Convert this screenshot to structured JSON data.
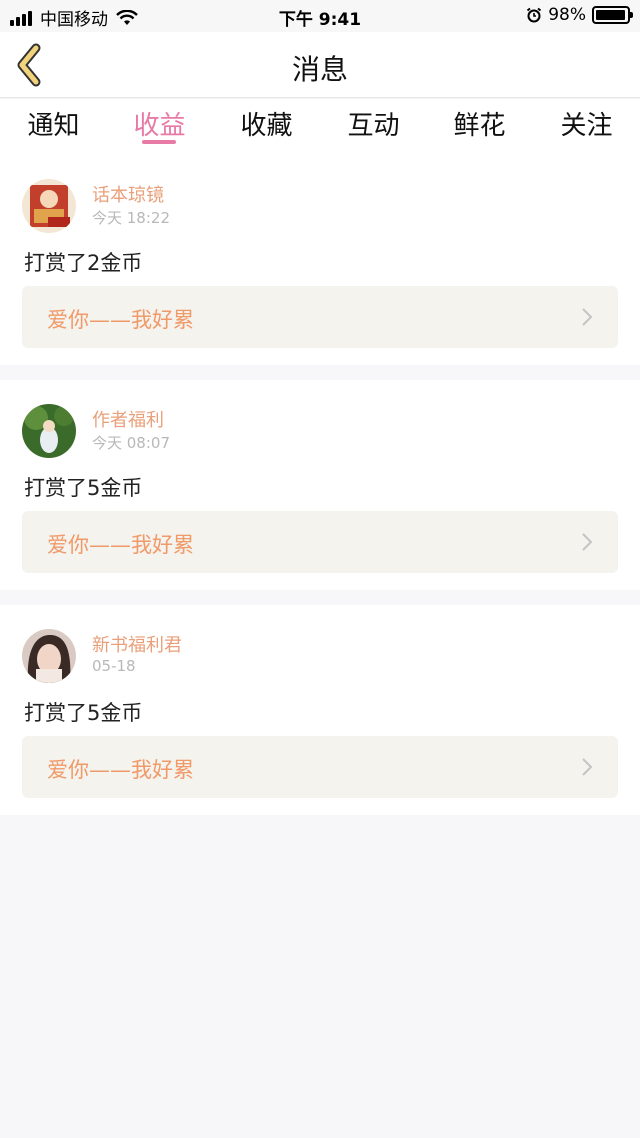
{
  "status": {
    "carrier": "中国移动",
    "time": "下午 9:41",
    "battery": "98%",
    "battery_level": 0.98
  },
  "nav": {
    "title": "消息"
  },
  "tabs": [
    {
      "label": "通知"
    },
    {
      "label": "收益"
    },
    {
      "label": "收藏"
    },
    {
      "label": "互动"
    },
    {
      "label": "鲜花"
    },
    {
      "label": "关注"
    }
  ],
  "active_tab": 1,
  "messages": [
    {
      "name": "话本琼镜",
      "time": "今天 18:22",
      "text": "打赏了2金币",
      "book": "爱你——我好累"
    },
    {
      "name": "作者福利",
      "time": "今天 08:07",
      "text": "打赏了5金币",
      "book": "爱你——我好累"
    },
    {
      "name": "新书福利君",
      "time": "05-18",
      "text": "打赏了5金币",
      "book": "爱你——我好累"
    }
  ],
  "colors": {
    "accent": "#e87aa6",
    "name": "#e9a07a",
    "book_title": "#f09a6a",
    "back_icon": "#f2d27a"
  }
}
